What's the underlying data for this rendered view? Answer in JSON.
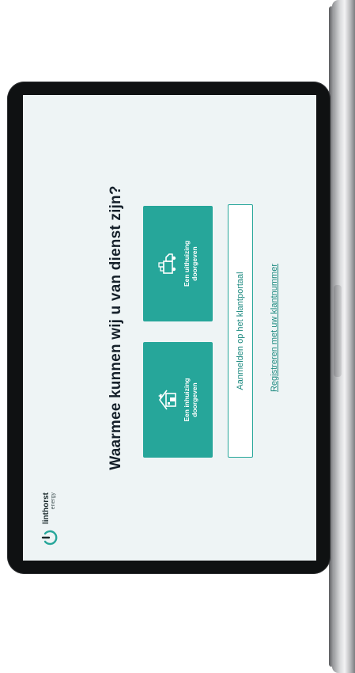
{
  "brand": {
    "name": "linthorst",
    "sub": "energy"
  },
  "heading": "Waarmee kunnen wij u van dienst zijn?",
  "options": [
    {
      "line1": "Een inhuizing",
      "line2": "doorgeven",
      "icon": "house-icon"
    },
    {
      "line1": "Een uithuizing",
      "line2": "doorgeven",
      "icon": "moving-truck-icon"
    }
  ],
  "login_label": "Aanmelden op het klantportaal",
  "register_label": "Registreren met uw klantnummer",
  "colors": {
    "accent": "#26a69a",
    "screen_bg": "#eef4f5",
    "bezel": "#0f1112"
  }
}
